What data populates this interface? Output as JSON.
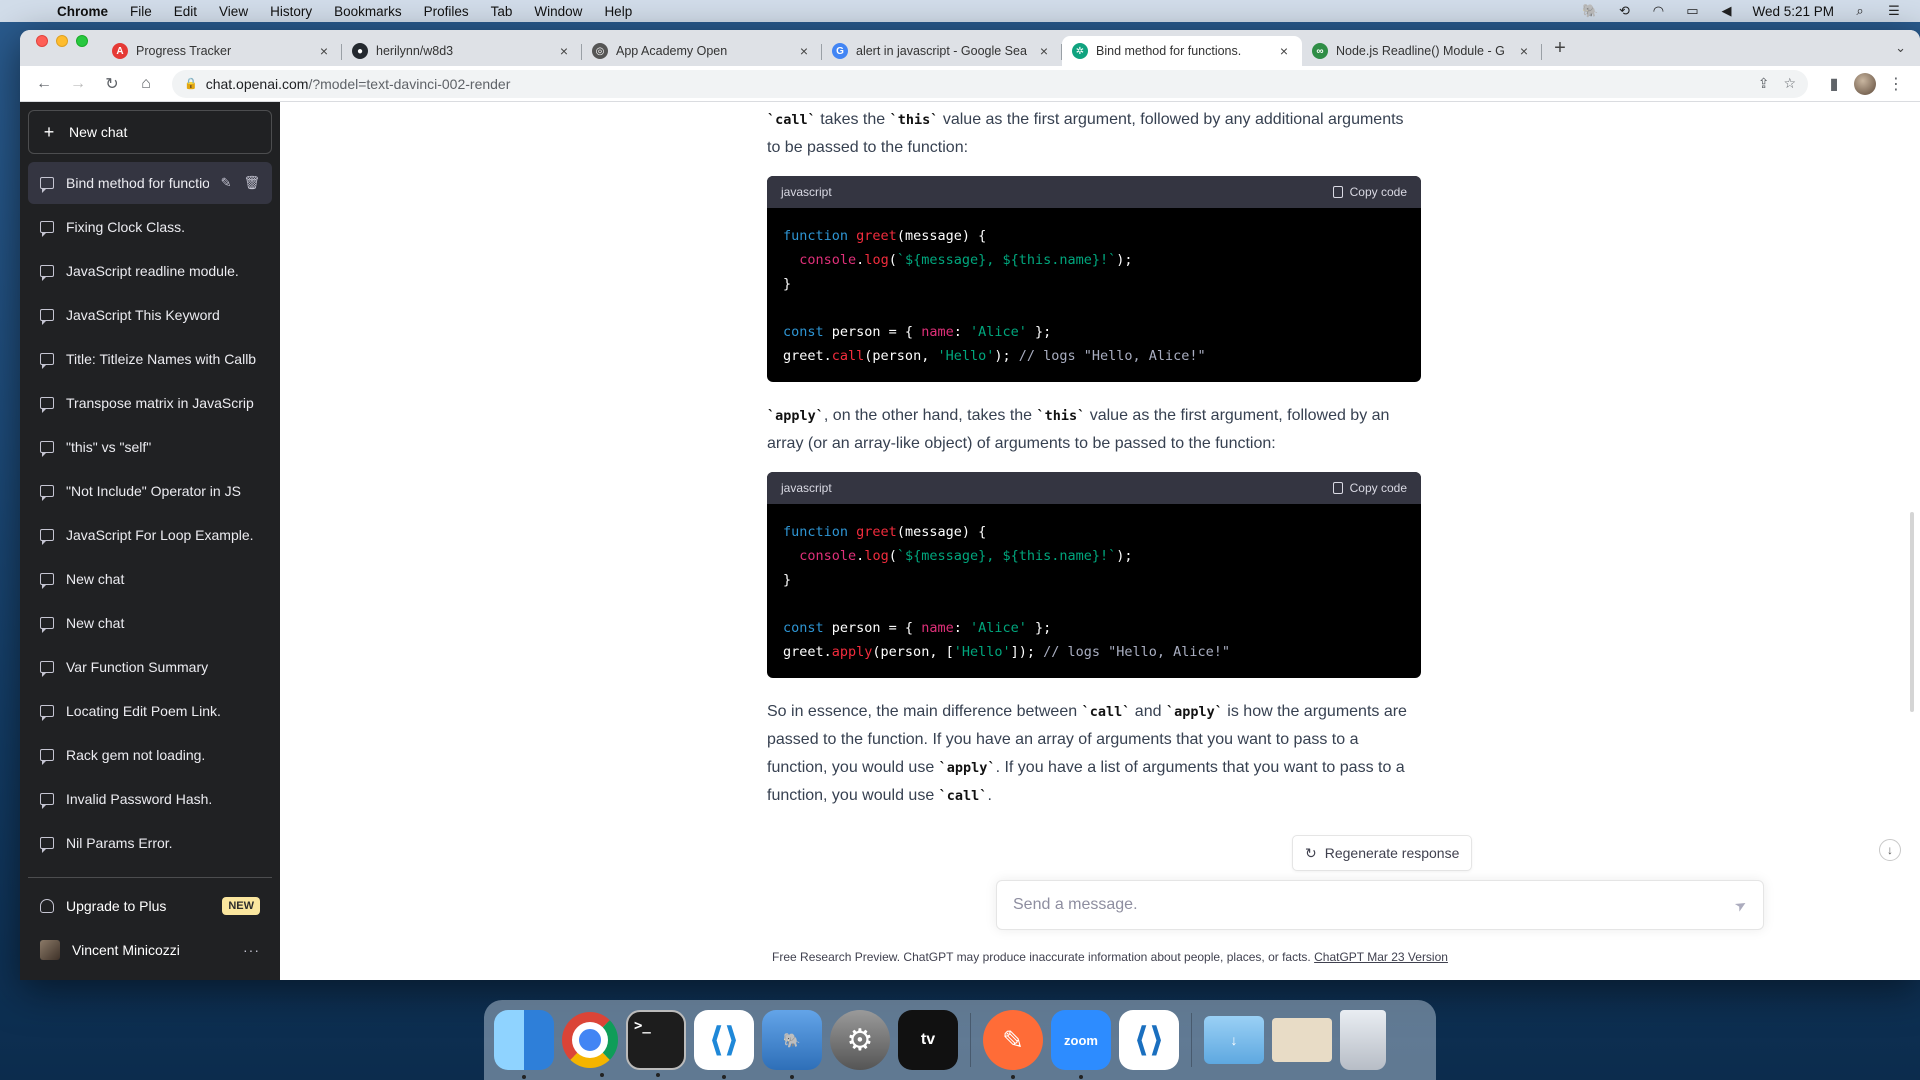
{
  "menubar": {
    "app": "Chrome",
    "items": [
      "File",
      "Edit",
      "View",
      "History",
      "Bookmarks",
      "Profiles",
      "Tab",
      "Window",
      "Help"
    ],
    "clock": "Wed 5:21 PM"
  },
  "browser": {
    "tabs": [
      {
        "title": "Progress Tracker",
        "favicon_color": "#e53935",
        "favicon": "A"
      },
      {
        "title": "herilynn/w8d3",
        "favicon_color": "#24292f",
        "favicon": "●"
      },
      {
        "title": "App Academy Open",
        "favicon_color": "#555555",
        "favicon": "◎"
      },
      {
        "title": "alert in javascript - Google Sea",
        "favicon_color": "#4285f4",
        "favicon": "G"
      },
      {
        "title": "Bind method for functions.",
        "favicon_color": "#10a37f",
        "favicon": "✲"
      },
      {
        "title": "Node.js Readline() Module - G",
        "favicon_color": "#2f8d46",
        "favicon": "∞"
      }
    ],
    "active_tab_index": 4,
    "url_host": "chat.openai.com",
    "url_path": "/?model=text-davinci-002-render"
  },
  "sidebar": {
    "new_chat": "New chat",
    "items": [
      "Bind method for functio",
      "Fixing Clock Class.",
      "JavaScript readline module.",
      "JavaScript This Keyword",
      "Title: Titleize Names with Callb",
      "Transpose matrix in JavaScrip",
      "\"this\" vs \"self\"",
      "\"Not Include\" Operator in JS",
      "JavaScript For Loop Example.",
      "New chat",
      "New chat",
      "Var Function Summary",
      "Locating Edit Poem Link.",
      "Rack gem not loading.",
      "Invalid Password Hash.",
      "Nil Params Error."
    ],
    "upgrade": "Upgrade to Plus",
    "new_badge": "NEW",
    "user_name": "Vincent Minicozzi"
  },
  "conversation": {
    "p1_code": "`call`",
    "p1_a": " takes the ",
    "p1_code2": "`this`",
    "p1_b": " value as the first argument, followed by any additional arguments to be passed to the function:",
    "code_lang": "javascript",
    "copy_label": "Copy code",
    "p2_code": "`apply`",
    "p2_a": ", on the other hand, takes the ",
    "p2_code2": "`this`",
    "p2_b": " value as the first argument, followed by an array (or an array-like object) of arguments to be passed to the function:",
    "p3_a": "So in essence, the main difference between ",
    "p3_code1": "`call`",
    "p3_b": " and ",
    "p3_code2": "`apply`",
    "p3_c": " is how the arguments are passed to the function. If you have an array of arguments that you want to pass to a function, you would use ",
    "p3_code3": "`apply`",
    "p3_d": ". If you have a list of arguments that you want to pass to a function, you would use ",
    "p3_code4": "`call`",
    "p3_e": "."
  },
  "regenerate": "Regenerate response",
  "input_placeholder": "Send a message.",
  "disclaimer": "Free Research Preview. ChatGPT may produce inaccurate information about people, places, or facts.",
  "disclaimer_link": "ChatGPT Mar 23 Version",
  "dock": [
    "finder",
    "chrome",
    "terminal",
    "vscode",
    "tableplus",
    "system-preferences",
    "apple-tv",
    "postman",
    "zoom",
    "vscode-insiders",
    "downloads",
    "preview",
    "trash"
  ],
  "dock_labels": {
    "terminal": ">_",
    "tv": "tv",
    "zoom": "zoom"
  }
}
